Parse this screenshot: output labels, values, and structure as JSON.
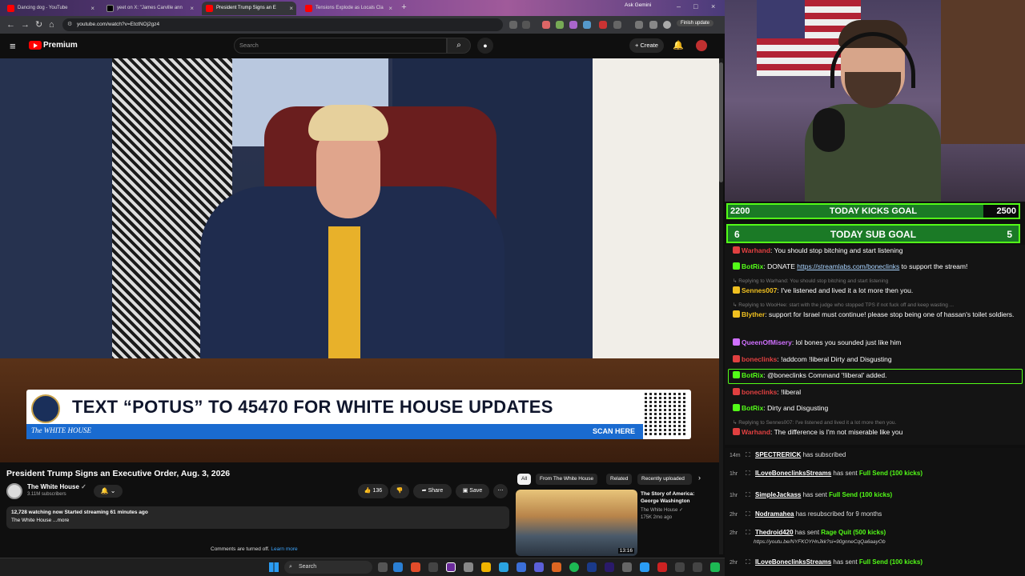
{
  "browser": {
    "tabs": [
      {
        "label": "Dancing dog - YouTube",
        "color": "#ff0000"
      },
      {
        "label": "yeet on X: \"James Carville ann",
        "color": "#222222"
      },
      {
        "label": "President Trump Signs an E",
        "color": "#ff0000"
      },
      {
        "label": "Tensions Explode as Locals Cla",
        "color": "#ff0000"
      }
    ],
    "ask_gemini": "Ask Gemini",
    "url": "youtube.com/watch?v=EtctNOj2gz4",
    "finish_update": "Finish update"
  },
  "youtube": {
    "brand": "Premium",
    "search_placeholder": "Search",
    "create_label": "Create",
    "video": {
      "banner_headline": "TEXT “POTUS” TO 45470 FOR WHITE HOUSE UPDATES",
      "banner_org": "The WHITE HOUSE",
      "banner_cta": "SCAN HERE"
    },
    "title": "President Trump Signs an Executive Order, Aug. 3, 2026",
    "channel": {
      "name": "The White House",
      "subscribers": "3.11M subscribers"
    },
    "likes": "136",
    "share_label": "Share",
    "save_label": "Save",
    "description": {
      "stats": "12,728 watching now  Started streaming 61 minutes ago",
      "text": "The White House ...more"
    },
    "comments_off": "Comments are turned off.",
    "learn_more": "Learn more",
    "chips": [
      "All",
      "From The White House",
      "Related",
      "Recently uploaded"
    ],
    "related": {
      "title": "The Story of America: George Washington",
      "channel": "The White House",
      "meta": "175K  2mo ago",
      "duration": "13:16"
    }
  },
  "taskbar": {
    "search": "Search"
  },
  "stream": {
    "kicks_goal": {
      "start": "2200",
      "label": "TODAY KICKS GOAL",
      "end": "2500",
      "progress": 0.88
    },
    "sub_goal": {
      "start": "6",
      "label": "TODAY SUB GOAL",
      "end": "5",
      "progress": 1.0
    },
    "chat": [
      {
        "type": "msg",
        "user": "Warhand",
        "color": "#e04040",
        "text": ": You should stop bitching and start listening"
      },
      {
        "type": "msg",
        "user": "BotRix",
        "color": "#53fc18",
        "text": ": DONATE ",
        "link": "https://streamlabs.com/boneclinks",
        "after": " to support the stream!"
      },
      {
        "type": "reply",
        "text": "Replying to Warhand: You should stop bitching and start listening"
      },
      {
        "type": "msg",
        "user": "Sennes007",
        "color": "#f0c020",
        "text": ": I've listened and lived it a lot more then you."
      },
      {
        "type": "reply",
        "text": "Replying to WooHee: start with the judge who stopped TPS if not fuck off and keep wasting ..."
      },
      {
        "type": "msg",
        "user": "Blyther",
        "color": "#f0c020",
        "text": ": support for Israel must continue! please stop being one of hassan's toilet soldiers."
      },
      {
        "type": "msg",
        "user": "QueenOfMisery",
        "color": "#d070ff",
        "text": ": lol bones you sounded just like him"
      },
      {
        "type": "msg",
        "user": "boneclinks",
        "color": "#e04040",
        "text": ": !addcom !liberal Dirty and Disgusting"
      },
      {
        "type": "msg",
        "user": "BotRix",
        "color": "#53fc18",
        "text": ": @boneclinks Command '!liberal' added."
      },
      {
        "type": "msg",
        "user": "boneclinks",
        "color": "#e04040",
        "text": ": !liberal"
      },
      {
        "type": "msg",
        "user": "BotRix",
        "color": "#53fc18",
        "text": ": Dirty and Disgusting"
      },
      {
        "type": "reply",
        "text": "Replying to Sennes007: I've listened and lived it a lot more then you."
      },
      {
        "type": "msg",
        "user": "Warhand",
        "color": "#e04040",
        "text": ": The difference is I'm not miserable like you"
      }
    ],
    "events": [
      {
        "time": "14m",
        "name": "SPECTRERICK",
        "text": " has subscribed",
        "gift": ""
      },
      {
        "time": "1hr",
        "name": "ILoveBoneclinksStreams",
        "text": " has sent ",
        "gift": "Full Send (100 kicks)"
      },
      {
        "time": "1hr",
        "name": "SimpleJackass",
        "text": " has sent ",
        "gift": "Full Send (100 kicks)"
      },
      {
        "time": "2hr",
        "name": "Nodramahea",
        "text": " has resubscribed for 9 months",
        "gift": ""
      },
      {
        "time": "2hr",
        "name": "Thedroid420",
        "text": " has sent ",
        "gift": "Rage Quit (500 kicks)",
        "sub": "https://youtu.be/NYFKOYHnJkk?si=90gnneCqQa6aayOb"
      },
      {
        "time": "2hr",
        "name": "ILoveBoneclinksStreams",
        "text": " has sent ",
        "gift": "Full Send (100 kicks)"
      }
    ]
  }
}
